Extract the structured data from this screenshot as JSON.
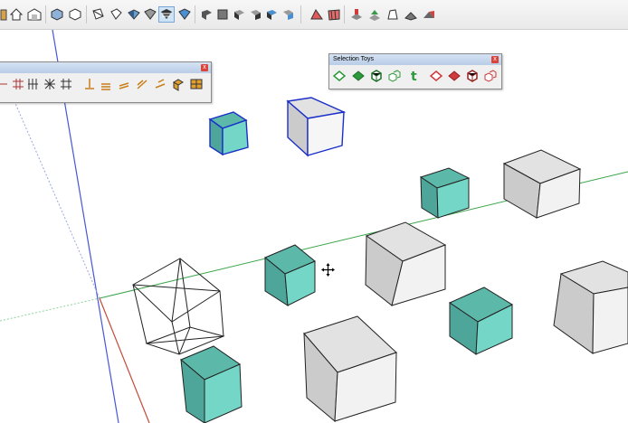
{
  "palettes": {
    "selection_toys": {
      "title": "Selection Toys",
      "close_label": "x"
    },
    "left_tools": {
      "close_label": "x"
    }
  },
  "selection_toys_icons": [
    "diamond-outline-icon",
    "diamond-filled-icon",
    "component-icon",
    "group-icon",
    "text-icon",
    "diamond-outline-red-icon",
    "diamond-filled-red-icon",
    "component-red-icon",
    "group-red-icon"
  ],
  "colors": {
    "teal_face": "#74d6c6",
    "teal_top": "#5cb9aa",
    "teal_side": "#4ea69a",
    "gray_top": "#e2e2e2",
    "gray_front": "#f2f2f2",
    "gray_side": "#cbcbcb",
    "selection_blue": "#1a2fc9",
    "green_axis": "#3aa64a",
    "red_axis": "#c44a3a",
    "blue_axis": "#4657d6"
  }
}
